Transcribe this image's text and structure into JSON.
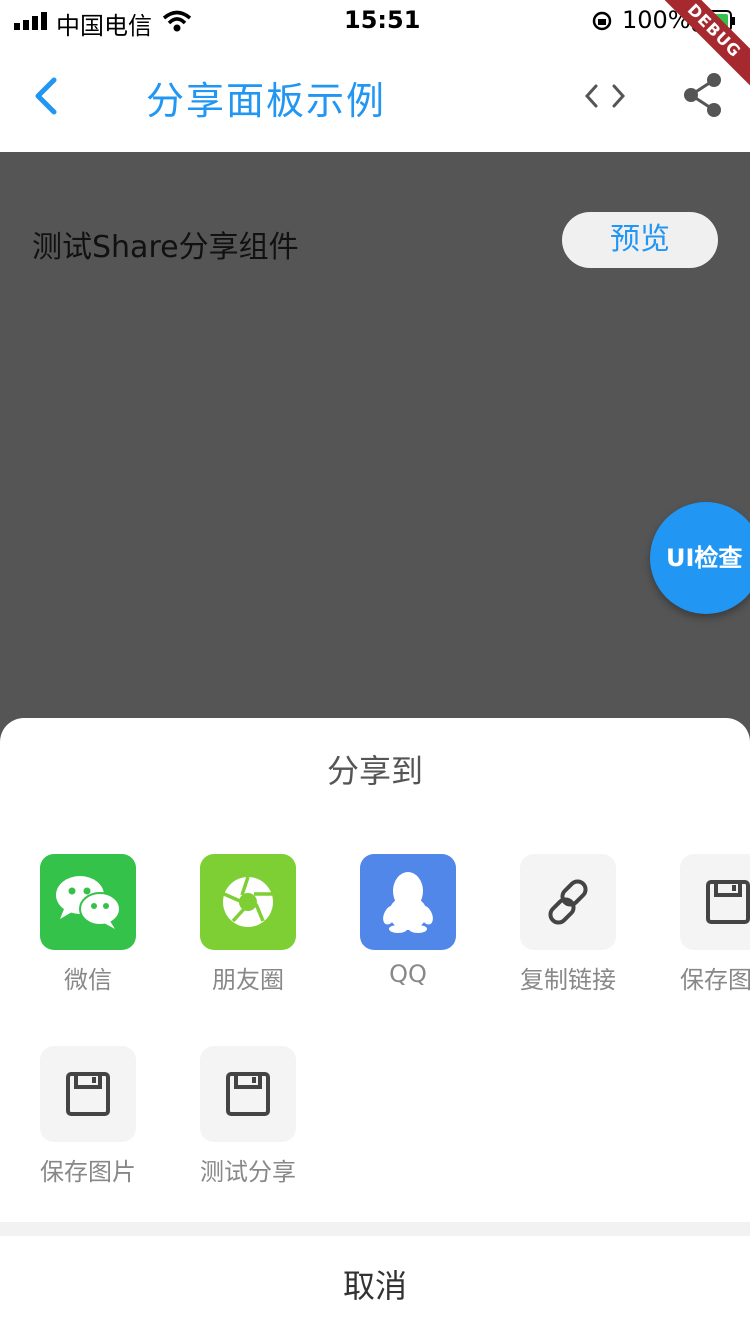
{
  "status": {
    "carrier": "中国电信",
    "time": "15:51",
    "battery": "100%"
  },
  "debug_banner": "DEBUG",
  "nav": {
    "title": "分享面板示例"
  },
  "content": {
    "label": "测试Share分享组件",
    "preview_button": "预览",
    "ui_check_button": "UI检查"
  },
  "sheet": {
    "title": "分享到",
    "items": [
      {
        "label": "微信",
        "icon": "wechat-icon",
        "color": "#35c24a"
      },
      {
        "label": "朋友圈",
        "icon": "moments-icon",
        "color": "#7ecf34"
      },
      {
        "label": "QQ",
        "icon": "qq-icon",
        "color": "#5087e8"
      },
      {
        "label": "复制链接",
        "icon": "link-icon",
        "color": "#f4f4f4"
      },
      {
        "label": "保存图",
        "icon": "save-icon",
        "color": "#f4f4f4"
      },
      {
        "label": "保存图片",
        "icon": "save-icon",
        "color": "#f4f4f4"
      },
      {
        "label": "测试分享",
        "icon": "save-icon",
        "color": "#f4f4f4"
      }
    ],
    "cancel": "取消"
  }
}
